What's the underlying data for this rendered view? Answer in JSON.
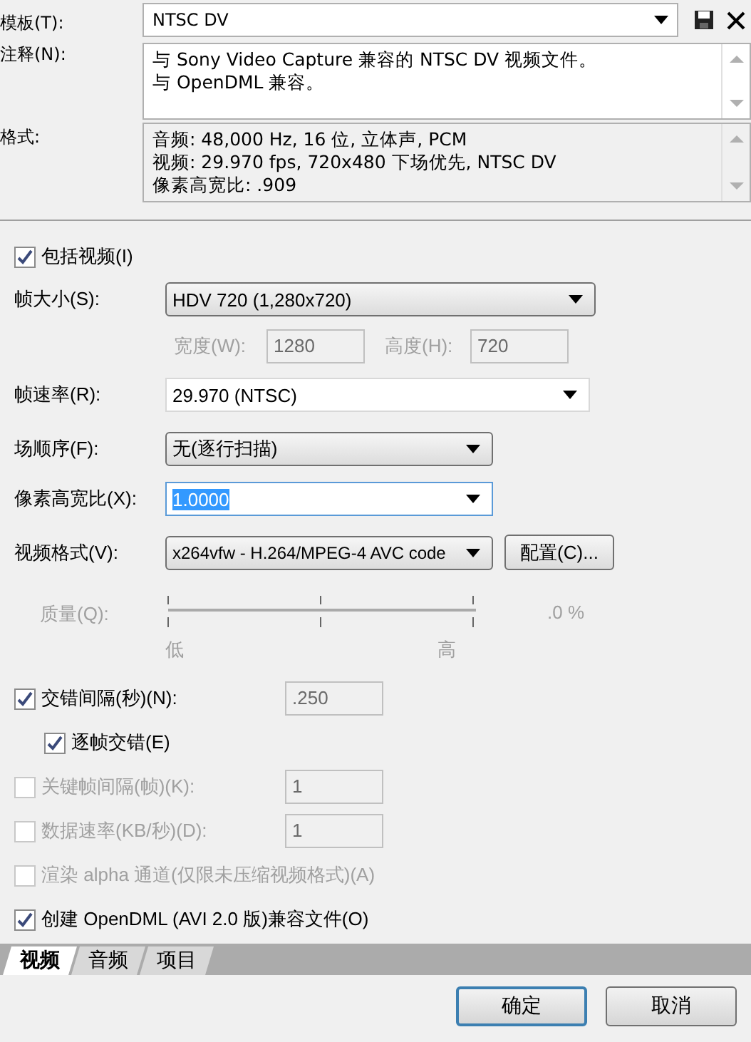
{
  "template": {
    "label": "模板(T):",
    "value": "NTSC DV"
  },
  "notes": {
    "label": "注释(N):",
    "lines": [
      "与 Sony Video Capture 兼容的 NTSC DV 视频文件。",
      "与 OpenDML 兼容。"
    ]
  },
  "format": {
    "label": "格式:",
    "lines": [
      "音频: 48,000 Hz, 16 位, 立体声, PCM",
      "视频: 29.970 fps, 720x480 下场优先, NTSC DV",
      "像素高宽比: .909"
    ]
  },
  "include_video": {
    "label": "包括视频(I)",
    "checked": true
  },
  "frame_size": {
    "label": "帧大小(S):",
    "value": "HDV 720 (1,280x720)"
  },
  "width": {
    "label": "宽度(W):",
    "value": "1280",
    "disabled": true
  },
  "height": {
    "label": "高度(H):",
    "value": "720",
    "disabled": true
  },
  "frame_rate": {
    "label": "帧速率(R):",
    "value": "29.970 (NTSC)"
  },
  "field_order": {
    "label": "场顺序(F):",
    "value": "无(逐行扫描)"
  },
  "pixel_aspect": {
    "label": "像素高宽比(X):",
    "value": "1.0000"
  },
  "video_format": {
    "label": "视频格式(V):",
    "value": "x264vfw - H.264/MPEG-4 AVC code",
    "button": "配置(C)..."
  },
  "quality": {
    "label": "质量(Q):",
    "reading": ".0 %",
    "low": "低",
    "high": "高",
    "disabled": true
  },
  "options": [
    {
      "label": "交错间隔(秒)(N):",
      "checked": true,
      "disabled": false,
      "indent": false,
      "value": ".250"
    },
    {
      "label": "逐帧交错(E)",
      "checked": true,
      "disabled": false,
      "indent": true
    },
    {
      "label": "关键帧间隔(帧)(K):",
      "checked": false,
      "disabled": true,
      "indent": false,
      "value": "1"
    },
    {
      "label": "数据速率(KB/秒)(D):",
      "checked": false,
      "disabled": true,
      "indent": false,
      "value": "1"
    },
    {
      "label": "渲染 alpha 通道(仅限未压缩视频格式)(A)",
      "checked": false,
      "disabled": true,
      "indent": false
    },
    {
      "label": "创建 OpenDML (AVI 2.0 版)兼容文件(O)",
      "checked": true,
      "disabled": false,
      "indent": false
    }
  ],
  "tabs": [
    {
      "label": "视频",
      "selected": true
    },
    {
      "label": "音频",
      "selected": false
    },
    {
      "label": "项目",
      "selected": false
    }
  ],
  "buttons": [
    {
      "label": "确定",
      "default": true
    },
    {
      "label": "取消",
      "default": false
    }
  ]
}
